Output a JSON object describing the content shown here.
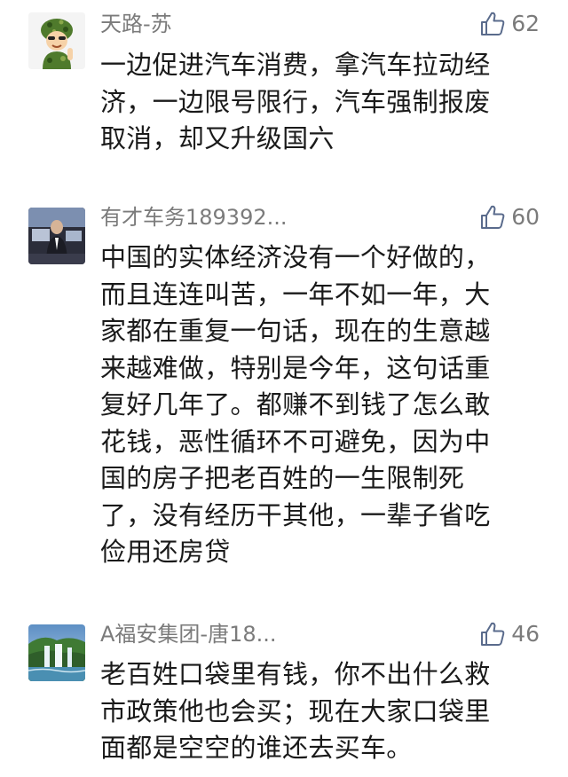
{
  "comments": [
    {
      "avatar_icon": "soldier-avatar-icon",
      "name": "天路-苏",
      "likes": "62",
      "text": "一边促进汽车消费，拿汽车拉动经\n济，一边限号限行，汽车强制报废\n取消，却又升级国六"
    },
    {
      "avatar_icon": "photo-avatar-icon",
      "name": "有才车务189392...",
      "likes": "60",
      "text": "中国的实体经济没有一个好做的，\n而且连连叫苦，一年不如一年，大\n家都在重复一句话，现在的生意越\n来越难做，特别是今年，这句话重\n复好几年了。都赚不到钱了怎么敢\n花钱，恶性循环不可避免，因为中\n国的房子把老百姓的一生限制死\n了，没有经历干其他，一辈子省吃\n俭用还房贷"
    },
    {
      "avatar_icon": "waterfall-avatar-icon",
      "name": "A福安集团-唐18...",
      "likes": "46",
      "text": "老百姓口袋里有钱，你不出什么救\n市政策他也会买；现在大家口袋里\n面都是空空的谁还去买车。"
    }
  ],
  "colors": {
    "name": "#7b7b7b",
    "text": "#1a1a1a",
    "like_icon": "#5a6b8c"
  }
}
